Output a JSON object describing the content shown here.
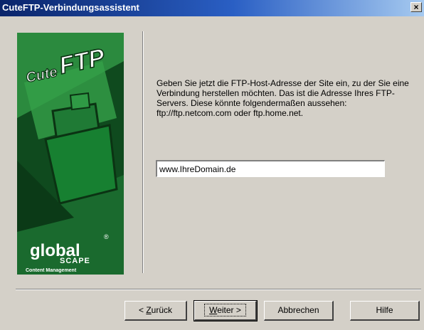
{
  "window": {
    "title": "CuteFTP-Verbindungsassistent",
    "close_glyph": "×"
  },
  "banner": {
    "logo_text": "CuteFTP",
    "logo_cute": "Cute",
    "logo_ftp": "FTP",
    "brand_global": "global",
    "brand_scape": "SCAPE",
    "brand_tagline": "Content Management",
    "registered": "®",
    "bg_color": "#1b6a2f"
  },
  "main": {
    "description": "Geben Sie jetzt die FTP-Host-Adresse der Site ein, zu der Sie eine Verbindung herstellen möchten. Das ist die Adresse Ihres FTP-Servers. Diese könnte folgendermaßen aussehen: ftp://ftp.netcom.com oder ftp.home.net.",
    "host_value": "www.IhreDomain.de"
  },
  "buttons": {
    "back_prefix": "< ",
    "back_mnemonic": "Z",
    "back_rest": "urück",
    "next_mnemonic": "W",
    "next_rest": "eiter >",
    "cancel": "Abbrechen",
    "help": "Hilfe"
  },
  "colors": {
    "titlebar_start": "#0a246a",
    "titlebar_end": "#a6caf0",
    "dialog_bg": "#d4d0c8"
  }
}
